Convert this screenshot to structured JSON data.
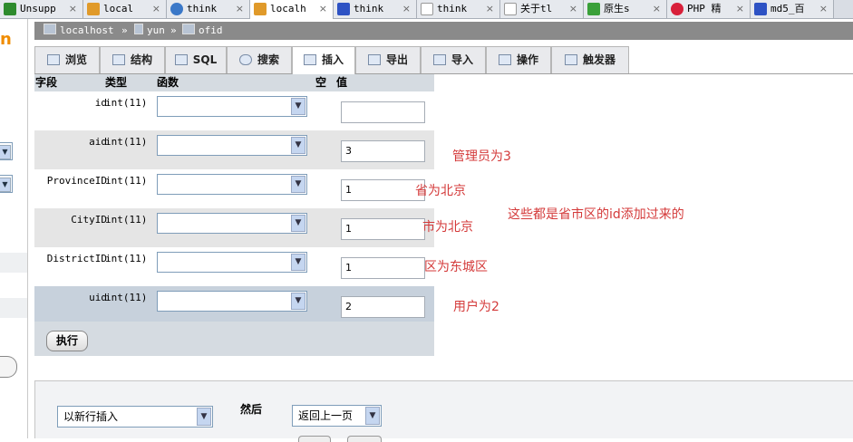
{
  "browser": {
    "tabs": [
      {
        "label": "Unsupp",
        "icon": "search-icon",
        "color": "#2e8b2e"
      },
      {
        "label": "local",
        "icon": "phpmyadmin-icon",
        "color": "#e09a2a"
      },
      {
        "label": "think",
        "icon": "globe-icon",
        "color": "#3a78c8"
      },
      {
        "label": "localh",
        "icon": "phpmyadmin-icon",
        "color": "#e09a2a",
        "active": true
      },
      {
        "label": "think",
        "icon": "paw-icon",
        "color": "#2d52c4"
      },
      {
        "label": "think",
        "icon": "page-icon",
        "color": "#999999"
      },
      {
        "label": "关于tl",
        "icon": "page-icon",
        "color": "#999999"
      },
      {
        "label": "原生s",
        "icon": "leaf-icon",
        "color": "#3aa03a"
      },
      {
        "label": "PHP 精",
        "icon": "c-icon",
        "color": "#d8203a"
      },
      {
        "label": "md5_百",
        "icon": "paw-icon",
        "color": "#2d52c4"
      }
    ],
    "close_glyph": "×"
  },
  "left_frame": {
    "logo_fragment": "n",
    "brand_color": "#f08c00"
  },
  "breadcrumb": {
    "server": "localhost",
    "separator": "»",
    "database": "yun",
    "table": "ofid"
  },
  "menu": {
    "tabs": [
      {
        "label": "浏览",
        "icon": "browse-icon"
      },
      {
        "label": "结构",
        "icon": "structure-icon"
      },
      {
        "label": "SQL",
        "icon": "sql-icon"
      },
      {
        "label": "搜索",
        "icon": "search-icon"
      },
      {
        "label": "插入",
        "icon": "insert-icon",
        "active": true
      },
      {
        "label": "导出",
        "icon": "export-icon"
      },
      {
        "label": "导入",
        "icon": "import-icon"
      },
      {
        "label": "操作",
        "icon": "wrench-icon"
      },
      {
        "label": "触发器",
        "icon": "trigger-icon"
      }
    ]
  },
  "form": {
    "headers": {
      "field": "字段",
      "type": "类型",
      "function": "函数",
      "null": "空",
      "value": "值"
    },
    "rows": [
      {
        "name": "id",
        "type": "int(11)",
        "function": "",
        "value": ""
      },
      {
        "name": "aid",
        "type": "int(11)",
        "function": "",
        "value": "3"
      },
      {
        "name": "ProvinceID",
        "type": "int(11)",
        "function": "",
        "value": "1"
      },
      {
        "name": "CityID",
        "type": "int(11)",
        "function": "",
        "value": "1"
      },
      {
        "name": "DistrictID",
        "type": "int(11)",
        "function": "",
        "value": "1"
      },
      {
        "name": "uid",
        "type": "int(11)",
        "function": "",
        "value": "2"
      }
    ],
    "row_colors": {
      "even": "#ffffff",
      "odd": "#e5e5e5",
      "hover": "#c7d1dc"
    },
    "go_label": "执行",
    "dropdown_glyph": "▼"
  },
  "annotations": {
    "aid": "管理员为3",
    "province": "省为北京",
    "city": "市为北京",
    "district": "区为东城区",
    "uid": "用户为2",
    "note": "这些都是省市区的id添加过来的",
    "color": "#d43a3a"
  },
  "lower": {
    "insert_mode": "以新行插入",
    "then_label": "然后",
    "after_action": "返回上一页"
  }
}
